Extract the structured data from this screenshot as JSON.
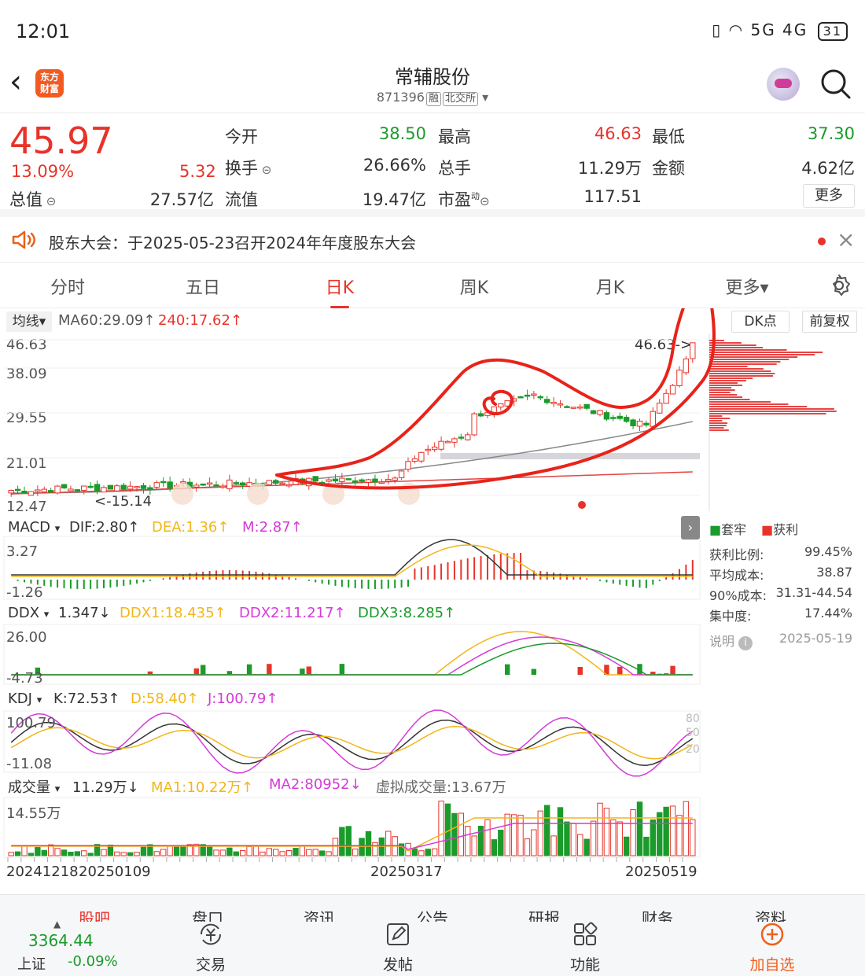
{
  "status_bar": {
    "time": "12:01",
    "signal_text": "5G 4G",
    "battery": "31"
  },
  "nav": {
    "back_icon": "chevron-left-icon",
    "app_logo": "东方财富",
    "stock_name": "常辅股份",
    "stock_code": "871396",
    "tag_margin": "融",
    "tag_exchange": "北交所",
    "search_icon": "search-icon"
  },
  "quote": {
    "price": "45.97",
    "change_pct": "13.09%",
    "change_abs": "5.32",
    "open_label": "今开",
    "open": "38.50",
    "high_label": "最高",
    "high": "46.63",
    "low_label": "最低",
    "low": "37.30",
    "turnover_label": "换手",
    "turnover": "26.66%",
    "volume_label": "总手",
    "volume": "11.29万",
    "amount_label": "金额",
    "amount": "4.62亿",
    "mktcap_label": "总值",
    "mktcap": "27.57亿",
    "float_label": "流值",
    "float_cap": "19.47亿",
    "pe_label": "市盈",
    "pe_sup": "动",
    "pe": "117.51",
    "more": "更多"
  },
  "notice": {
    "text": "股东大会：于2025-05-23召开2024年年度股东大会",
    "close_icon": "close-icon"
  },
  "tabs": [
    "分时",
    "五日",
    "日K",
    "周K",
    "月K",
    "更多▾"
  ],
  "active_tab": "日K",
  "main_chart": {
    "indicator_select": "均线▾",
    "ma60": "MA60:29.09↑",
    "ma240": "240:17.62↑",
    "dk_button": "DK点",
    "adjust_button": "前复权",
    "y_ticks": [
      "46.63",
      "38.09",
      "29.55",
      "21.01",
      "12.47"
    ],
    "high_marker": "46.63->",
    "low_marker": "<-15.14"
  },
  "chip": {
    "legend_trapped": "套牢",
    "legend_profit": "获利",
    "rows": [
      {
        "label": "获利比例:",
        "value": "99.45%"
      },
      {
        "label": "平均成本:",
        "value": "38.87"
      },
      {
        "label": "90%成本:",
        "value": "31.31-44.54"
      },
      {
        "label": "集中度:",
        "value": "17.44%"
      }
    ],
    "note_label": "说明",
    "date": "2025-05-19"
  },
  "macd": {
    "name": "MACD",
    "dif": "DIF:2.80↑",
    "dea": "DEA:1.36↑",
    "m": "M:2.87↑",
    "top": "3.27",
    "bottom": "-1.26"
  },
  "ddx": {
    "name": "DDX",
    "v": "1.347↓",
    "d1": "DDX1:18.435↑",
    "d2": "DDX2:11.217↑",
    "d3": "DDX3:8.285↑",
    "top": "26.00",
    "bottom": "-4.73"
  },
  "kdj": {
    "name": "KDJ",
    "k": "K:72.53↑",
    "d": "D:58.40↑",
    "j": "J:100.79↑",
    "top": "100.79",
    "bottom": "-11.08",
    "right_ticks": [
      "80",
      "50",
      "20"
    ]
  },
  "vol": {
    "name": "成交量",
    "v": "11.29万↓",
    "ma1": "MA1:10.22万↑",
    "ma2": "MA2:80952↓",
    "virtual": "虚拟成交量:13.67万",
    "top": "14.55万"
  },
  "x_dates": [
    "20241218",
    "20250109",
    "20250317",
    "20250519"
  ],
  "bottom_tabs": [
    "股吧",
    "盘口",
    "资讯",
    "公告",
    "研报",
    "财务",
    "资料"
  ],
  "index": {
    "value": "3364.44",
    "name": "上证",
    "pct": "-0.09%"
  },
  "bottom_nav": [
    {
      "label": "交易",
      "icon": "yuan-exchange-icon"
    },
    {
      "label": "发帖",
      "icon": "edit-post-icon"
    },
    {
      "label": "功能",
      "icon": "grid-icon"
    },
    {
      "label": "加自选",
      "icon": "add-circle-icon"
    }
  ],
  "colors": {
    "up": "#e8332a",
    "down": "#1a9b2b",
    "ma_yellow": "#f2b619",
    "ma_magenta": "#d53ad8",
    "annotation": "#e8231a"
  }
}
